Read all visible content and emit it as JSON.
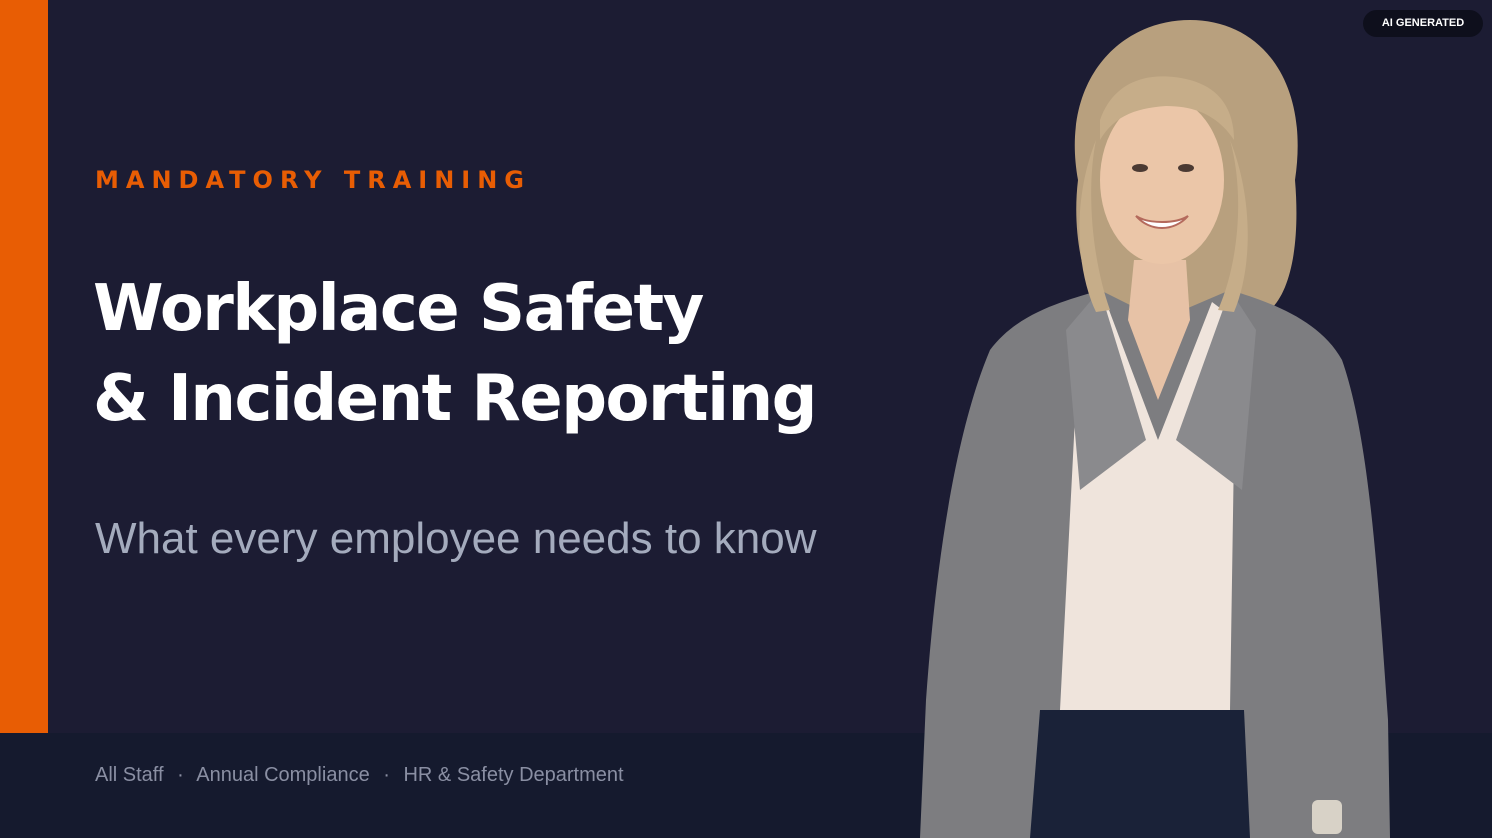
{
  "slide": {
    "eyebrow": "MANDATORY TRAINING",
    "title_line_1": "Workplace Safety",
    "title_line_2": "& Incident Reporting",
    "subtitle": "What every employee needs to know",
    "badge": "AI GENERATED"
  },
  "footer": {
    "items": [
      "All Staff",
      "Annual Compliance",
      "HR & Safety Department"
    ],
    "separator": "·"
  },
  "colors": {
    "background": "#1c1c33",
    "accent": "#e85d04",
    "footer_background": "#151a2e",
    "title": "#ffffff",
    "subtitle": "#a4abbd",
    "footer_text": "#8a8fa3"
  }
}
